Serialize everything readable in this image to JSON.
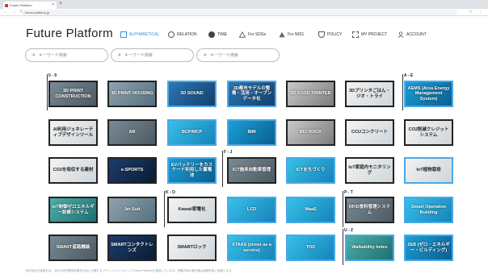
{
  "browser": {
    "tab_title": "Future Platform",
    "url": "future-platform.jp"
  },
  "header": {
    "logo": "Future Platform",
    "menu": {
      "alphabetical": "ALPHABETICAL",
      "relation": "RELATION",
      "time": "TIME",
      "sdgs": "For SDGs",
      "ndg": "For NDG",
      "policy": "POLICY",
      "project": "MY PROJECT",
      "account": "ACCOUNT"
    }
  },
  "search": {
    "placeholder1": "キーワード検索",
    "placeholder2": "キーワード検索",
    "placeholder3": "キーワード検索"
  },
  "groups": {
    "g09": "0 - 9",
    "ae": "A - E",
    "fj": "F - J",
    "ko": "K - O",
    "pt": "P - T",
    "uz": "U - Z"
  },
  "tiles": [
    "3D PRINT CONSTRUCTION",
    "3D PRINT HOUSING",
    "3D SOUND",
    "3D都市モデルの整備・活用・オープンデータ化",
    "3D FOOD PRINTER",
    "3Dプリンタごはん・ジオ・トライ",
    "AEMS (Area Energy Management System)",
    "AI利用ジェネレーティブデザインツール",
    "AR",
    "BCP/MCP",
    "BIM",
    "BIO ROCK",
    "CCUコンクリート",
    "CO2削減クレジットシステム",
    "CO2を吸収する建材",
    "e-SPORTS",
    "EVバッテリーをカスケード利用した蓄電池",
    "ICT施来自動車管理",
    "ICTまちづくり",
    "IoT家庭内モニタリング",
    "IoT植物栽培",
    "IoT制御ゼロエネルギー設備システム",
    "Jet Suit",
    "Kawaii家電化",
    "LCD",
    "MaaS",
    "RFID食料管理システム",
    "Smart Operation Building",
    "SMART道路舗装",
    "SMARTコンタクトレンズ",
    "SMARTロック",
    "STAAS (street as a service)",
    "TOD",
    "Walkability Index",
    "ZEB (ゼロ・エネルギー・ビルディング)"
  ],
  "footer": "株式会社日建設計は、当社の研究開発成果を社会に公開するプラットフォームとしてFuture Platformを運営しています。掲載内容の著作権は各権利者に帰属します。"
}
